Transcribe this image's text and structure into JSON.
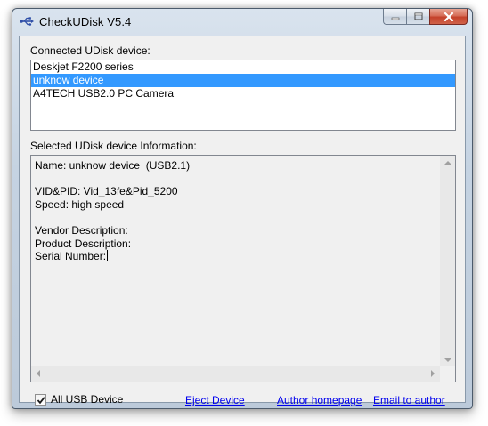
{
  "window": {
    "title": "CheckUDisk V5.4",
    "app_icon": "usb-icon"
  },
  "caption_buttons": {
    "minimize_icon": "minimize-icon",
    "maximize_icon": "maximize-icon",
    "close_icon": "close-icon"
  },
  "devices": {
    "label": "Connected UDisk device:",
    "items": [
      {
        "label": "Deskjet F2200 series",
        "selected": false
      },
      {
        "label": "unknow device",
        "selected": true
      },
      {
        "label": "A4TECH USB2.0 PC Camera",
        "selected": false
      }
    ]
  },
  "info": {
    "label": "Selected UDisk device Information:",
    "lines": [
      "Name: unknow device  (USB2.1)",
      "",
      "VID&PID: Vid_13fe&Pid_5200",
      "Speed: high speed",
      "",
      "Vendor Description:",
      "Product Description:",
      "Serial Number:"
    ]
  },
  "footer": {
    "all_usb_label": "All USB Device",
    "all_usb_checked": true,
    "eject_label": "Eject Device",
    "homepage_label": "Author homepage",
    "email_label": "Email to author"
  },
  "colors": {
    "selection": "#3399ff",
    "link": "#0000ee",
    "close_button": "#c4412a"
  }
}
